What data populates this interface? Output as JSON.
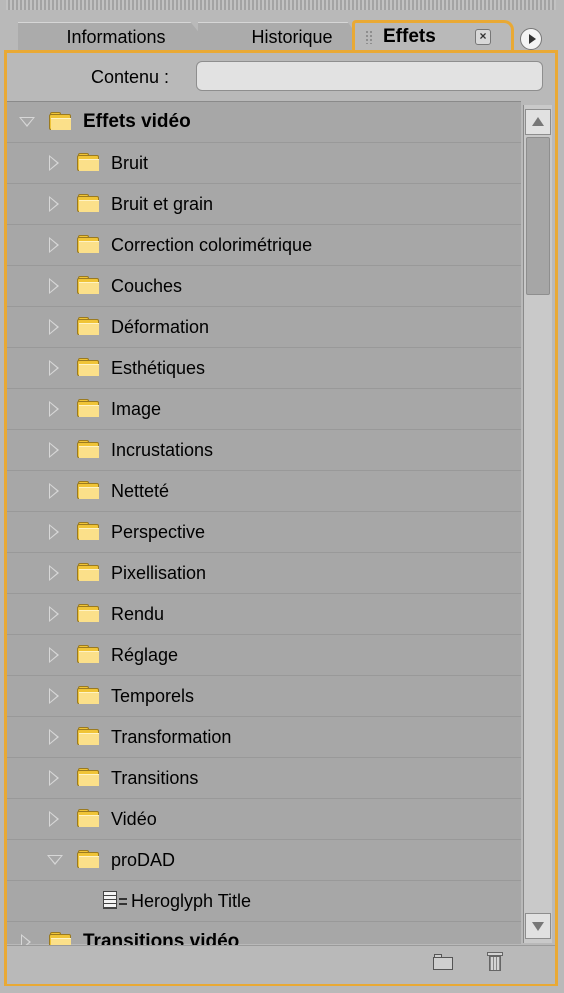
{
  "tabs": [
    {
      "label": "Informations",
      "active": false
    },
    {
      "label": "Historique",
      "active": false
    },
    {
      "label": "Effets",
      "active": true
    }
  ],
  "close_icon": "×",
  "search": {
    "label": "Contenu :",
    "value": "",
    "placeholder": ""
  },
  "tree": [
    {
      "label": "Effets vidéo",
      "level": 0,
      "expanded": true,
      "type": "folder",
      "bold": true
    },
    {
      "label": "Bruit",
      "level": 1,
      "expanded": false,
      "type": "folder"
    },
    {
      "label": "Bruit et grain",
      "level": 1,
      "expanded": false,
      "type": "folder"
    },
    {
      "label": "Correction colorimétrique",
      "level": 1,
      "expanded": false,
      "type": "folder"
    },
    {
      "label": "Couches",
      "level": 1,
      "expanded": false,
      "type": "folder"
    },
    {
      "label": "Déformation",
      "level": 1,
      "expanded": false,
      "type": "folder"
    },
    {
      "label": "Esthétiques",
      "level": 1,
      "expanded": false,
      "type": "folder"
    },
    {
      "label": "Image",
      "level": 1,
      "expanded": false,
      "type": "folder"
    },
    {
      "label": "Incrustations",
      "level": 1,
      "expanded": false,
      "type": "folder"
    },
    {
      "label": "Netteté",
      "level": 1,
      "expanded": false,
      "type": "folder"
    },
    {
      "label": "Perspective",
      "level": 1,
      "expanded": false,
      "type": "folder"
    },
    {
      "label": "Pixellisation",
      "level": 1,
      "expanded": false,
      "type": "folder"
    },
    {
      "label": "Rendu",
      "level": 1,
      "expanded": false,
      "type": "folder"
    },
    {
      "label": "Réglage",
      "level": 1,
      "expanded": false,
      "type": "folder"
    },
    {
      "label": "Temporels",
      "level": 1,
      "expanded": false,
      "type": "folder"
    },
    {
      "label": "Transformation",
      "level": 1,
      "expanded": false,
      "type": "folder"
    },
    {
      "label": "Transitions",
      "level": 1,
      "expanded": false,
      "type": "folder"
    },
    {
      "label": "Vidéo",
      "level": 1,
      "expanded": false,
      "type": "folder"
    },
    {
      "label": "proDAD",
      "level": 1,
      "expanded": true,
      "type": "folder"
    },
    {
      "label": "Heroglyph Title",
      "level": 2,
      "type": "effect"
    },
    {
      "label": "Transitions vidéo",
      "level": 0,
      "expanded": false,
      "type": "folder",
      "bold": true
    }
  ],
  "colors": {
    "active_border": "#e9a934",
    "folder": "#f0c437",
    "list_bg": "#a7a7a7"
  },
  "icons": {
    "menu": "panel-menu-icon",
    "new_bin": "new-bin-icon",
    "delete": "trash-icon"
  }
}
